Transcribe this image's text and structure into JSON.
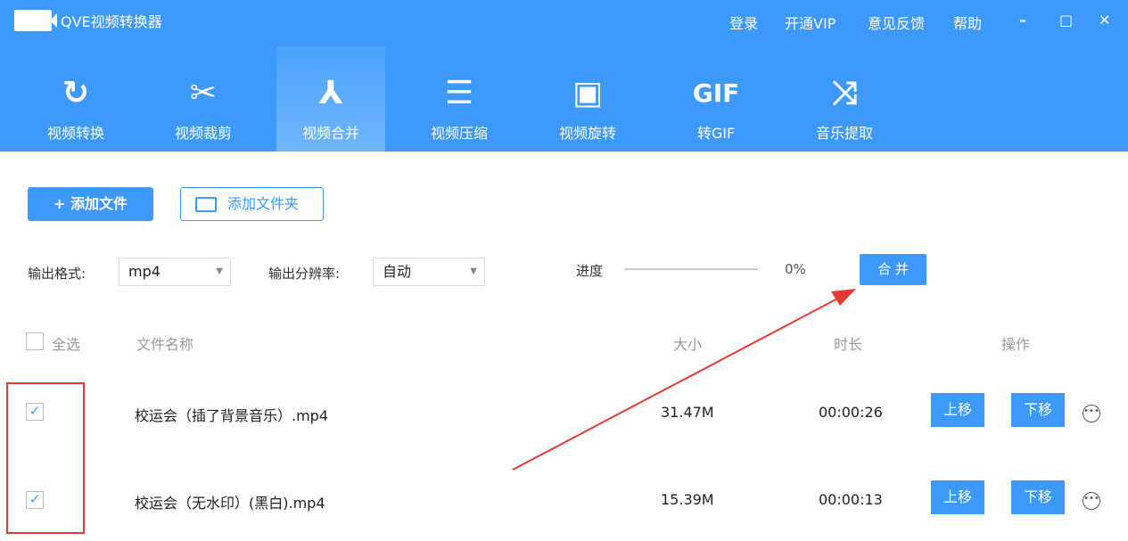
{
  "app": {
    "title": "QVE视频转换器"
  },
  "menu": {
    "login": "登录",
    "vip": "开通VIP",
    "feedback": "意见反馈",
    "help": "帮助",
    "minimize": "–",
    "maximize": "□",
    "close": "✕"
  },
  "tabs": [
    {
      "label": "视频转换",
      "icon": "↻"
    },
    {
      "label": "视频裁剪",
      "icon": "✂"
    },
    {
      "label": "视频合并",
      "icon": "⅄"
    },
    {
      "label": "视频压缩",
      "icon": "☰"
    },
    {
      "label": "视频旋转",
      "icon": "▣"
    },
    {
      "label": "转GIF",
      "icon": "GIF"
    },
    {
      "label": "音乐提取",
      "icon": "⤨"
    }
  ],
  "toolbar": {
    "add_file": "+ 添加文件",
    "add_folder": "添加文件夹"
  },
  "options": {
    "format_label": "输出格式:",
    "format_value": "mp4",
    "resolution_label": "输出分辨率:",
    "resolution_value": "自动",
    "progress_label": "进度",
    "progress_value": "0%",
    "progress": 0,
    "merge": "合 并"
  },
  "table": {
    "select_all": "全选",
    "headers": {
      "name": "文件名称",
      "size": "大小",
      "duration": "时长",
      "actions": "操作"
    },
    "rows": [
      {
        "checked": true,
        "name": "校运会（插了背景音乐）.mp4",
        "size": "31.47M",
        "duration": "00:00:26",
        "up": "上移",
        "down": "下移",
        "more": "•••"
      },
      {
        "checked": true,
        "name": "校运会（无水印）(黑白).mp4",
        "size": "15.39M",
        "duration": "00:00:13",
        "up": "上移",
        "down": "下移",
        "more": "•••"
      }
    ]
  },
  "check": "✓",
  "colors": {
    "primary": "#3e99fc",
    "annotation": "#e53935"
  }
}
